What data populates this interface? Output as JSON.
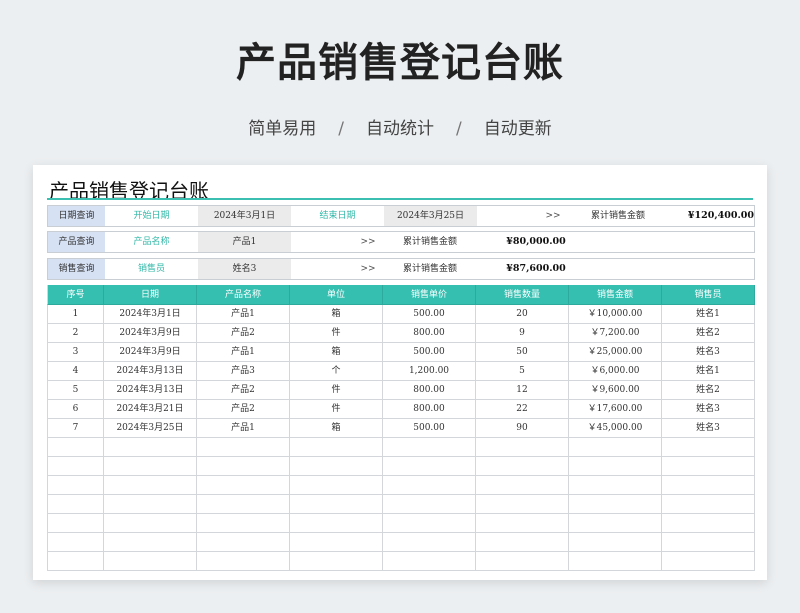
{
  "page": {
    "title": "产品销售登记台账",
    "subtitle": [
      "简单易用",
      "自动统计",
      "自动更新"
    ],
    "subtitle_sep": "/"
  },
  "sheet": {
    "title": "产品销售登记台账",
    "date_query": {
      "label": "日期查询",
      "start_field": "开始日期",
      "start_value": "2024年3月1日",
      "end_field": "结束日期",
      "end_value": "2024年3月25日",
      "arrow": ">>",
      "total_label": "累计销售金额",
      "total_value": "¥120,400.00"
    },
    "product_query": {
      "label": "产品查询",
      "field": "产品名称",
      "value": "产品1",
      "arrow": ">>",
      "total_label": "累计销售金额",
      "total_value": "¥80,000.00"
    },
    "seller_query": {
      "label": "销售查询",
      "field": "销售员",
      "value": "姓名3",
      "arrow": ">>",
      "total_label": "累计销售金额",
      "total_value": "¥87,600.00"
    },
    "table": {
      "headers": [
        "序号",
        "日期",
        "产品名称",
        "单位",
        "销售单价",
        "销售数量",
        "销售金额",
        "销售员"
      ],
      "rows": [
        [
          "1",
          "2024年3月1日",
          "产品1",
          "箱",
          "500.00",
          "20",
          "￥10,000.00",
          "姓名1"
        ],
        [
          "2",
          "2024年3月9日",
          "产品2",
          "件",
          "800.00",
          "9",
          "￥7,200.00",
          "姓名2"
        ],
        [
          "3",
          "2024年3月9日",
          "产品1",
          "箱",
          "500.00",
          "50",
          "￥25,000.00",
          "姓名3"
        ],
        [
          "4",
          "2024年3月13日",
          "产品3",
          "个",
          "1,200.00",
          "5",
          "￥6,000.00",
          "姓名1"
        ],
        [
          "5",
          "2024年3月13日",
          "产品2",
          "件",
          "800.00",
          "12",
          "￥9,600.00",
          "姓名2"
        ],
        [
          "6",
          "2024年3月21日",
          "产品2",
          "件",
          "800.00",
          "22",
          "￥17,600.00",
          "姓名3"
        ],
        [
          "7",
          "2024年3月25日",
          "产品1",
          "箱",
          "500.00",
          "90",
          "￥45,000.00",
          "姓名3"
        ]
      ],
      "empty_rows": 7
    },
    "colors": {
      "accent": "#35bfb1",
      "label_bg": "#d6e1f3",
      "value_bg": "#ebebeb"
    }
  }
}
